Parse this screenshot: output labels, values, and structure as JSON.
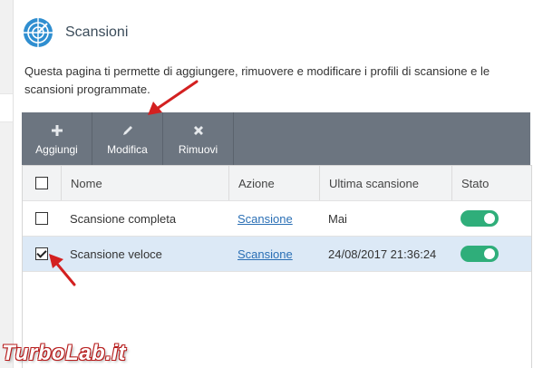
{
  "header": {
    "title": "Scansioni",
    "logo_icon": "radar-icon"
  },
  "description": "Questa pagina ti permette di aggiungere, rimuovere e modificare i profili di scansione e le scansioni programmate.",
  "toolbar": {
    "buttons": [
      {
        "label": "Aggiungi",
        "icon": "plus-icon"
      },
      {
        "label": "Modifica",
        "icon": "pencil-icon"
      },
      {
        "label": "Rimuovi",
        "icon": "x-icon"
      }
    ],
    "background": "#6c7580"
  },
  "table": {
    "headers": [
      "Nome",
      "Azione",
      "Ultima scansione",
      "Stato"
    ],
    "rows": [
      {
        "checked": false,
        "name": "Scansione completa",
        "action": "Scansione",
        "last": "Mai",
        "status_on": true
      },
      {
        "checked": true,
        "name": "Scansione veloce",
        "action": "Scansione",
        "last": "24/08/2017 21:36:24",
        "status_on": true
      }
    ]
  },
  "colors": {
    "toggle_on": "#2fae7a",
    "selected_row": "#dce9f6",
    "annotation_arrow": "#d32020",
    "link": "#2a6fb5"
  },
  "watermark": {
    "text": "TurboLab.it"
  }
}
